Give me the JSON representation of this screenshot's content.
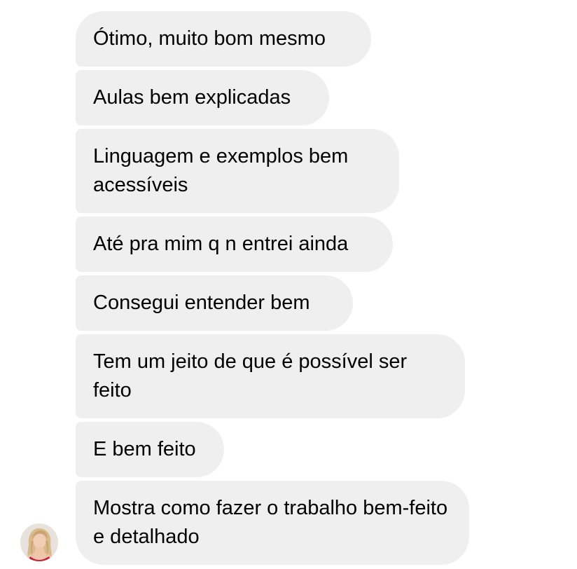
{
  "messages": [
    "Ótimo, muito bom mesmo",
    "Aulas bem explicadas",
    "Linguagem e exemplos bem acessíveis",
    "Até pra mim q n entrei ainda",
    "Consegui entender bem",
    "Tem um jeito de que é possível ser feito",
    "E bem feito",
    "Mostra como fazer o trabalho bem-feito e detalhado"
  ],
  "colors": {
    "bubble_background": "#efefef",
    "text": "#000000",
    "page_background": "#ffffff"
  },
  "sender": {
    "avatar_icon": "user-avatar-photo"
  }
}
